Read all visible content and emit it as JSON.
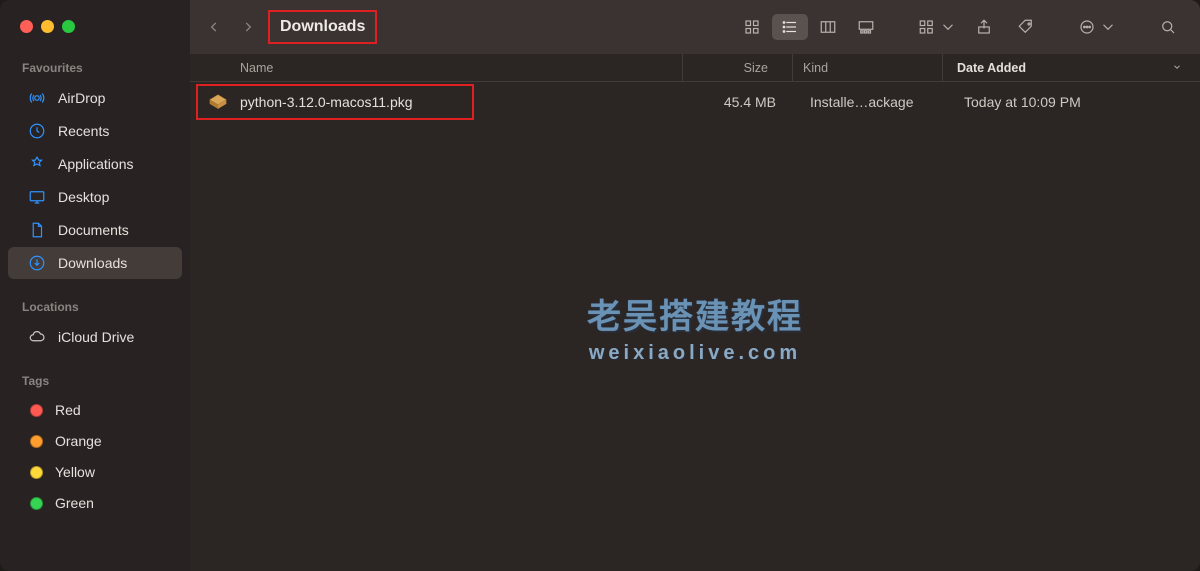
{
  "toolbar": {
    "title": "Downloads"
  },
  "sidebar": {
    "favourites_label": "Favourites",
    "favourites": [
      {
        "label": "AirDrop"
      },
      {
        "label": "Recents"
      },
      {
        "label": "Applications"
      },
      {
        "label": "Desktop"
      },
      {
        "label": "Documents"
      },
      {
        "label": "Downloads"
      }
    ],
    "locations_label": "Locations",
    "locations": [
      {
        "label": "iCloud Drive"
      }
    ],
    "tags_label": "Tags",
    "tags": [
      {
        "label": "Red",
        "color": "#ff5a52"
      },
      {
        "label": "Orange",
        "color": "#ff9e2e"
      },
      {
        "label": "Yellow",
        "color": "#ffd93a"
      },
      {
        "label": "Green",
        "color": "#36d452"
      }
    ]
  },
  "columns": {
    "name": "Name",
    "size": "Size",
    "kind": "Kind",
    "date": "Date Added"
  },
  "files": [
    {
      "name": "python-3.12.0-macos11.pkg",
      "size": "45.4 MB",
      "kind": "Installe…ackage",
      "date": "Today at 10:09 PM"
    }
  ],
  "watermark": {
    "line1": "老吴搭建教程",
    "line2": "weixiaolive.com"
  }
}
